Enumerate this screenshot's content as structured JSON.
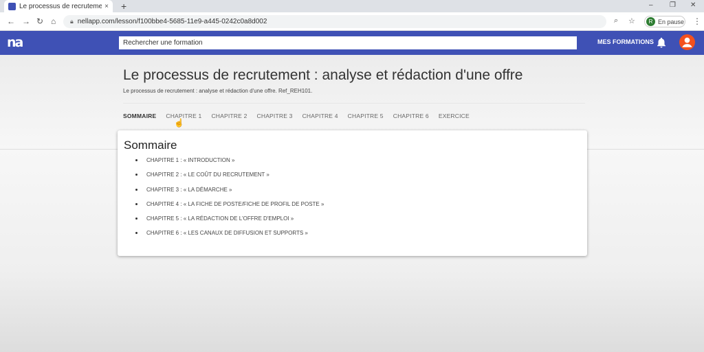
{
  "browser": {
    "tab_title": "Le processus de recrutement : an",
    "tab_close": "×",
    "new_tab": "+",
    "url": "nellapp.com/lesson/f100bbe4-5685-11e9-a445-0242c0a8d002",
    "profile_initial": "R",
    "profile_status": "En pause",
    "window_controls": [
      "–",
      "❐",
      "✕"
    ]
  },
  "header": {
    "logo": "na",
    "search_placeholder": "Rechercher une formation",
    "nav_label": "MES FORMATIONS"
  },
  "lesson": {
    "title": "Le processus de recrutement : analyse et rédaction d'une offre",
    "subtitle": "Le processus de recrutement : analyse et rédaction d'une offre. Ref_REH101.",
    "tabs": [
      "SOMMAIRE",
      "CHAPITRE 1",
      "CHAPITRE 2",
      "CHAPITRE 3",
      "CHAPITRE 4",
      "CHAPITRE 5",
      "CHAPITRE 6",
      "EXERCICE"
    ]
  },
  "summary": {
    "title": "Sommaire",
    "items": [
      "CHAPITRE 1 : « INTRODUCTION »",
      "CHAPITRE 2 : « LE COÛT DU RECRUTEMENT »",
      "CHAPITRE 3 : « LA DÉMARCHE »",
      "CHAPITRE 4 : « LA FICHE DE POSTE/FICHE DE PROFIL DE POSTE »",
      "CHAPITRE 5 : « LA RÉDACTION DE L'OFFRE D'EMPLOI »",
      "CHAPITRE 6 : « LES CANAUX DE DIFFUSION ET SUPPORTS »"
    ]
  },
  "colors": {
    "primary": "#3f51b5",
    "accent": "#f4511e"
  },
  "icons": {
    "bell": "bell-icon",
    "user": "user-icon",
    "search": "search-icon",
    "star": "star-icon"
  }
}
